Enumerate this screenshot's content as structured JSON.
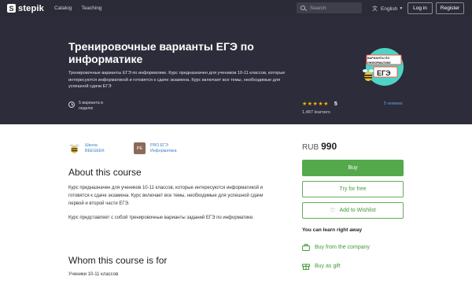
{
  "nav": {
    "logo_mark": "S",
    "logo_text": "stepik",
    "links": [
      "Catalog",
      "Teaching"
    ],
    "search_placeholder": "Search",
    "language": "English",
    "login_label": "Log in",
    "register_label": "Register"
  },
  "course": {
    "title": "Тренировочные варианты ЕГЭ по информатике",
    "description": "Тренировочные варианты ЕГЭ по информатике. Курс предназначен для учеников 10-11 классов, которые интересуются информатикой и готовятся к сдаче экзамена. Курс включает все темы, необходимые для успешной сдачи ЕГЭ",
    "duration": "5 варианта в неделю",
    "stars": "★★★★★",
    "rating": "5",
    "learners": "1,487 learners",
    "reviews": "5 reviews",
    "cover": {
      "line1": "ВАРИАНТЫ ПО",
      "line2": "ИНФОРМАТИКЕ",
      "line3": "ЕГЭ"
    }
  },
  "authors": [
    {
      "avatar": "🐝",
      "name": "Школа BEEGEEK"
    },
    {
      "avatar": "PE",
      "name": "PRO ЕГЭ Информатика"
    }
  ],
  "about": {
    "heading": "About this course",
    "p1": "Курс предназначен для учеников 10-11 классов, которые интересуются информатикой и готовятся к сдаче экзамена. Курс включает все темы, необходимые для успешной сдачи первой и второй части ЕГЭ.",
    "p2": "Курс представляет с собой тренировочные варианты заданий ЕГЭ по информатике."
  },
  "audience": {
    "heading": "Whom this course is for",
    "text": "Ученики 10-11 классов"
  },
  "purchase": {
    "currency": "RUB",
    "price": "990",
    "buy_label": "Buy",
    "try_label": "Try for free",
    "wishlist_label": "Add to Wishlist",
    "learn_title": "You can learn right away",
    "company_label": "Buy from the company",
    "gift_label": "Buy as gift"
  },
  "colors": {
    "nav_bg": "#2b2b37",
    "hero_bg": "#2c2c3b",
    "accent_green": "#54a94b",
    "link_blue": "#3b7ec6",
    "star": "#f6b400"
  },
  "icons": [
    "stepik-logo-icon",
    "search-icon",
    "translate-icon",
    "clock-icon",
    "heart-icon",
    "briefcase-icon",
    "gift-icon",
    "bee-icon"
  ]
}
